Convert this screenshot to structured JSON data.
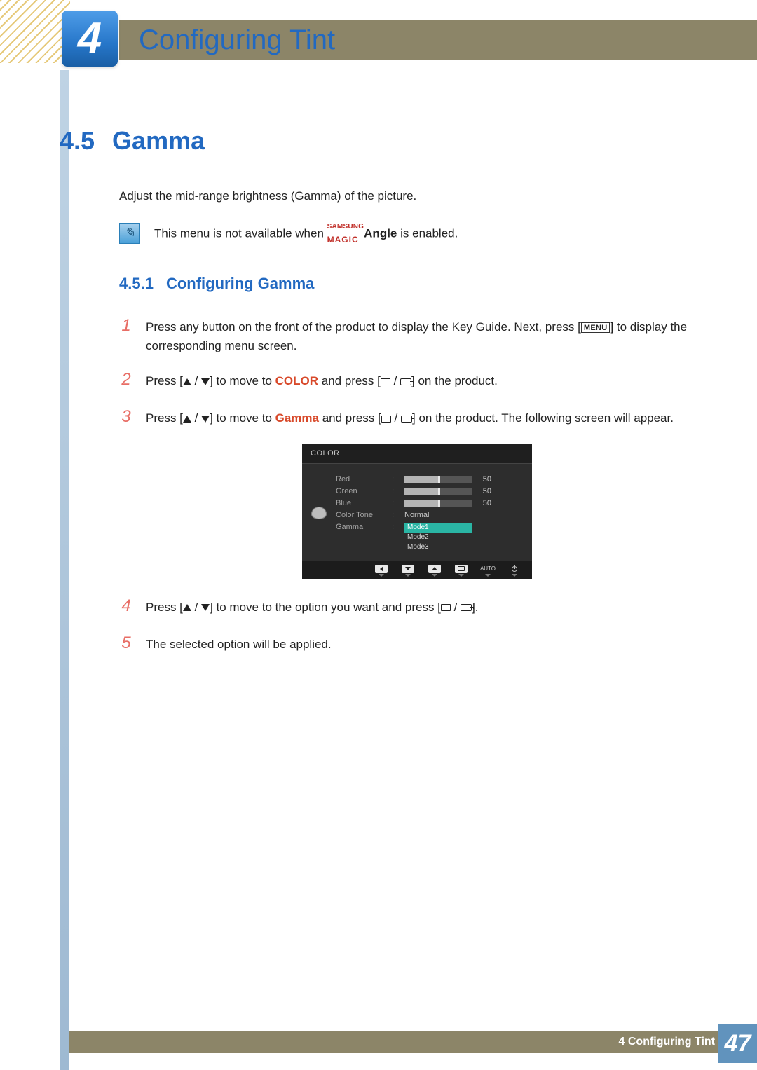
{
  "header": {
    "chapter_number": "4",
    "chapter_title": "Configuring Tint"
  },
  "section": {
    "number": "4.5",
    "title": "Gamma"
  },
  "intro": "Adjust the mid-range brightness (Gamma) of the picture.",
  "note": {
    "pre": "This menu is not available when ",
    "samsung": "SAMSUNG",
    "magic": "MAGIC",
    "angle": "Angle",
    "post": " is enabled."
  },
  "subsection": {
    "number": "4.5.1",
    "title": "Configuring Gamma"
  },
  "steps": {
    "s1": {
      "n": "1",
      "a": "Press any button on the front of the product to display the Key Guide. Next, press [",
      "menu": "MENU",
      "b": "] to display the corresponding menu screen."
    },
    "s2": {
      "n": "2",
      "a": "Press [",
      "b": "] to move to ",
      "kw": "COLOR",
      "c": " and press [",
      "d": "] on the product."
    },
    "s3": {
      "n": "3",
      "a": "Press [",
      "b": "] to move to ",
      "kw": "Gamma",
      "c": " and press [",
      "d": "] on the product. The following screen will appear."
    },
    "s4": {
      "n": "4",
      "a": "Press [",
      "b": "] to move to the option you want and press [",
      "c": "]."
    },
    "s5": {
      "n": "5",
      "a": "The selected option will be applied."
    }
  },
  "osd": {
    "title": "COLOR",
    "labels": {
      "red": "Red",
      "green": "Green",
      "blue": "Blue",
      "colortone": "Color Tone",
      "gamma": "Gamma"
    },
    "values": {
      "red": "50",
      "green": "50",
      "blue": "50",
      "colortone": "Normal"
    },
    "gamma_opts": {
      "m1": "Mode1",
      "m2": "Mode2",
      "m3": "Mode3"
    },
    "keyrow_auto": "AUTO"
  },
  "footer": {
    "text": "4 Configuring Tint",
    "page": "47"
  }
}
